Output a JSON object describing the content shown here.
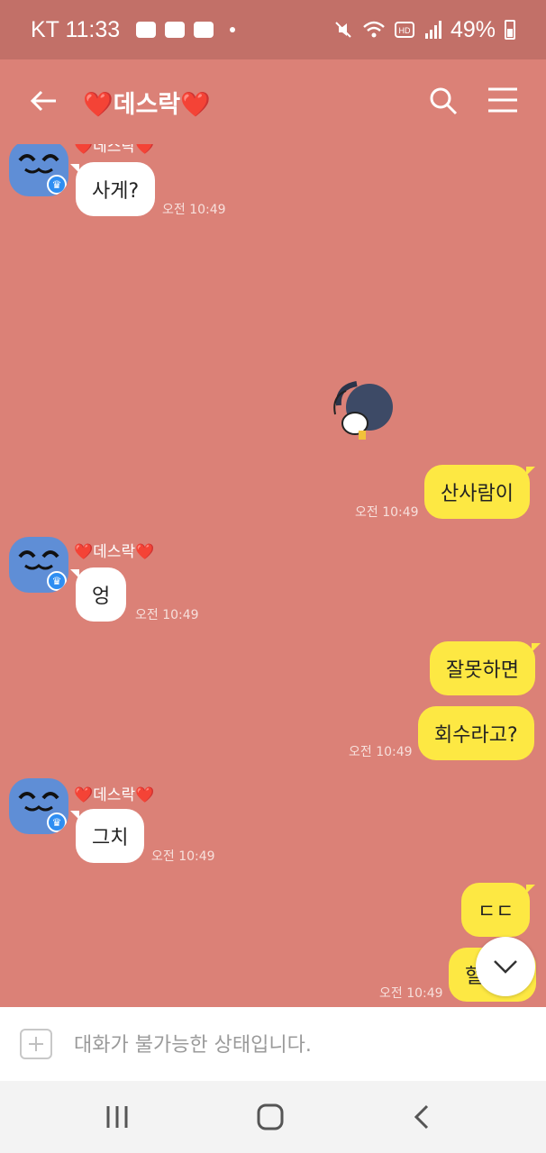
{
  "status_bar": {
    "carrier_time": "KT 11:33",
    "battery_text": "49%",
    "icons_left": [
      "talk-icon",
      "gallery-icon",
      "youtube-icon",
      "dot-icon"
    ],
    "icons_right": [
      "mute-icon",
      "wifi-icon",
      "hd-icon",
      "signal-icon",
      "battery-icon"
    ]
  },
  "header": {
    "title": "❤️데스락❤️"
  },
  "messages": [
    {
      "type": "in",
      "sender": "❤️데스락❤️",
      "text": "사게?",
      "time": "오전 10:49"
    },
    {
      "type": "sticker",
      "time": ""
    },
    {
      "type": "out",
      "text": "산사람이",
      "time": "오전 10:49"
    },
    {
      "type": "in",
      "sender": "❤️데스락❤️",
      "text": "엉",
      "time": "오전 10:49"
    },
    {
      "type": "out",
      "text": "잘못하면",
      "time": ""
    },
    {
      "type": "out",
      "text": "회수라고?",
      "time": "오전 10:49"
    },
    {
      "type": "in",
      "sender": "❤️데스락❤️",
      "text": "그치",
      "time": "오전 10:49"
    },
    {
      "type": "out",
      "text": "ㄷㄷ",
      "time": ""
    },
    {
      "type": "out",
      "text": "헐ㄷㄷ",
      "time": "오전 10:49"
    }
  ],
  "input": {
    "placeholder": "대화가 불가능한 상태입니다."
  },
  "colors": {
    "background": "#db8177",
    "status_bar": "#c27068",
    "bubble_out": "#fde843",
    "bubble_in": "#ffffff"
  }
}
